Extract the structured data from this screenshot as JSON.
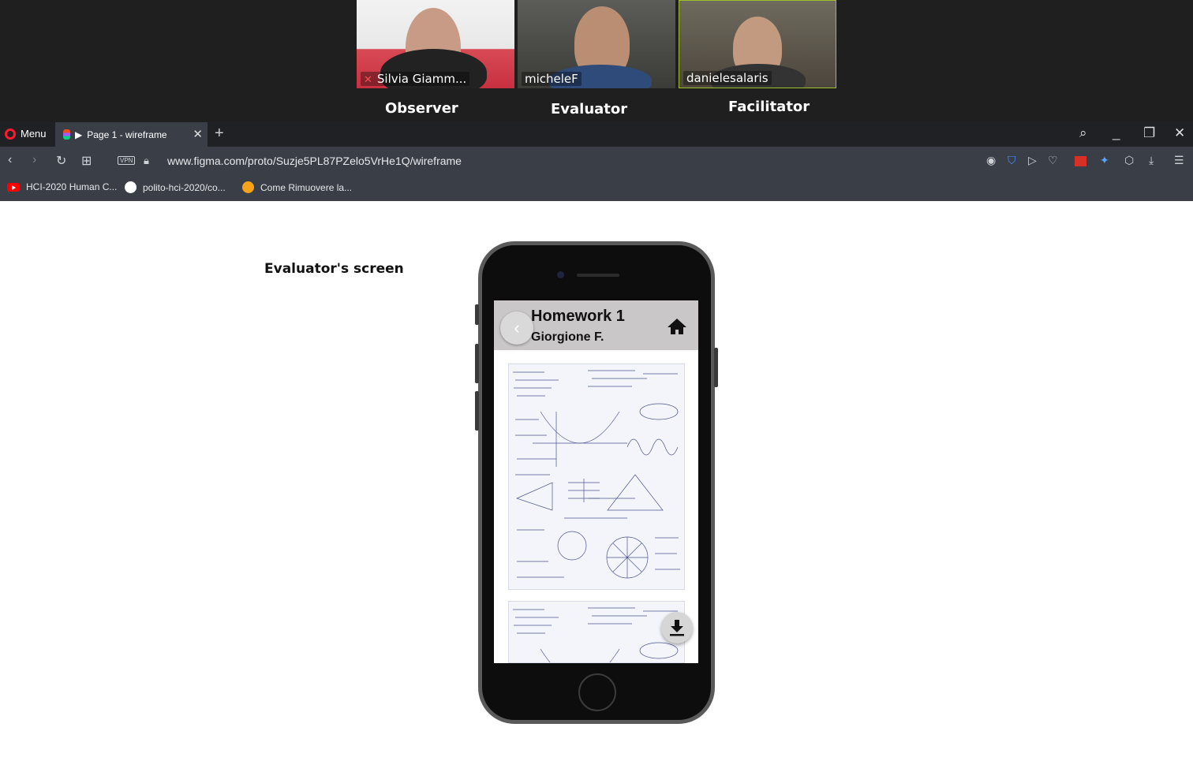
{
  "call": {
    "participants": [
      {
        "name": "Silvia Giamm...",
        "muted": true
      },
      {
        "name": "micheleF",
        "muted": false
      },
      {
        "name": "danielesalaris",
        "muted": false
      }
    ],
    "roles": [
      "Observer",
      "Evaluator",
      "Facilitator"
    ]
  },
  "browser": {
    "menu_label": "Menu",
    "tab_title": "Page 1 - wireframe",
    "vpn_label": "VPN",
    "url": "www.figma.com/proto/Suzje5PL87PZelo5VrHe1Q/wireframe",
    "bookmarks": [
      "HCI-2020 Human C...",
      "polito-hci-2020/co...",
      "Come Rimuovere la..."
    ],
    "accent_color": "#ff1b2d"
  },
  "page": {
    "evaluator_label": "Evaluator's screen"
  },
  "app": {
    "title": "Homework 1",
    "subtitle": "Giorgione F.",
    "header_color": "#c9c7c7"
  }
}
